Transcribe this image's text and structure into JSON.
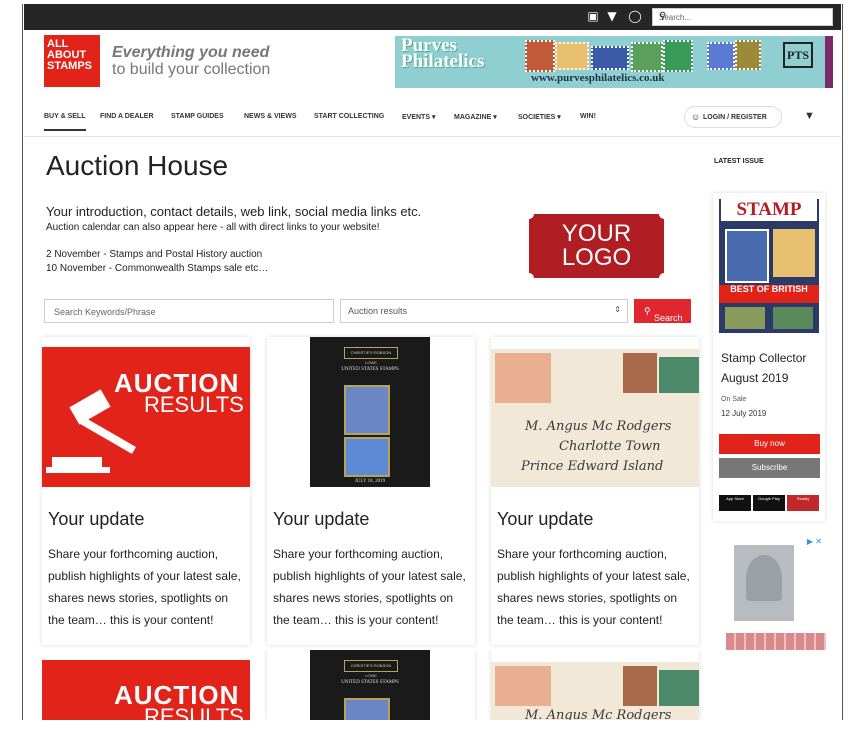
{
  "topbar": {
    "social": [
      "facebook-icon",
      "twitter-icon",
      "instagram-icon"
    ],
    "search_placeholder": "Search..."
  },
  "brand": {
    "logo_lines": [
      "ALL",
      "ABOUT",
      "STAMPS"
    ],
    "tagline_1": "Everything you need",
    "tagline_2": "to build your collection"
  },
  "ad_banner": {
    "name_1": "Purves",
    "name_2": "Philatelics",
    "url": "www.purvesphilatelics.co.uk",
    "badge": "PTS"
  },
  "nav": {
    "items": [
      "BUY & SELL",
      "FIND A DEALER",
      "STAMP GUIDES",
      "NEWS & VIEWS",
      "START COLLECTING",
      "EVENTS ▾",
      "MAGAZINE ▾",
      "SOCIETIES ▾",
      "WIN!"
    ],
    "login": "LOGIN / REGISTER"
  },
  "main": {
    "title": "Auction House",
    "intro": "Your introduction, contact details, web link, social media links etc.",
    "intro_sub": "Auction calendar can also appear here - all with direct links to your website!",
    "line1": "2 November - Stamps and Postal History auction",
    "line2": "10 November - Commonwealth Stamps sale etc…",
    "logo_line1": "YOUR",
    "logo_line2": "LOGO"
  },
  "search": {
    "keyword_placeholder": "Search Keywords/Phrase",
    "select_value": "Auction results",
    "button": "Search"
  },
  "cards": [
    {
      "title": "Your update",
      "text": "Share your forthcoming auction, publish highlights of your latest sale, shares news stories, spotlights on the team… this is your content!"
    },
    {
      "title": "Your update",
      "text": "Share your forthcoming auction, publish highlights of your latest sale, shares news stories, spotlights on the team… this is your content!"
    },
    {
      "title": "Your update",
      "text": "Share your forthcoming auction, publish highlights of your latest sale, shares news stories, spotlights on the team… this is your content!"
    }
  ],
  "auction_image": {
    "line1": "AUCTION",
    "line2": "RESULTS"
  },
  "book_image": {
    "header": "CHRISTIE'S ROBSON LOWE",
    "title": "UNITED STATES STAMPS",
    "date": "JULY 18, 2019"
  },
  "sidebar": {
    "heading": "LATEST ISSUE",
    "cover_title": "STAMP",
    "cover_banner": "BEST OF BRITISH",
    "magazine": "Stamp Collector",
    "issue": "August 2019",
    "on_sale_label": "On Sale",
    "on_sale_date": "12 July 2019",
    "buy": "Buy now",
    "subscribe": "Subscribe",
    "stores": [
      "App Store",
      "Google Play",
      "Readly"
    ]
  }
}
